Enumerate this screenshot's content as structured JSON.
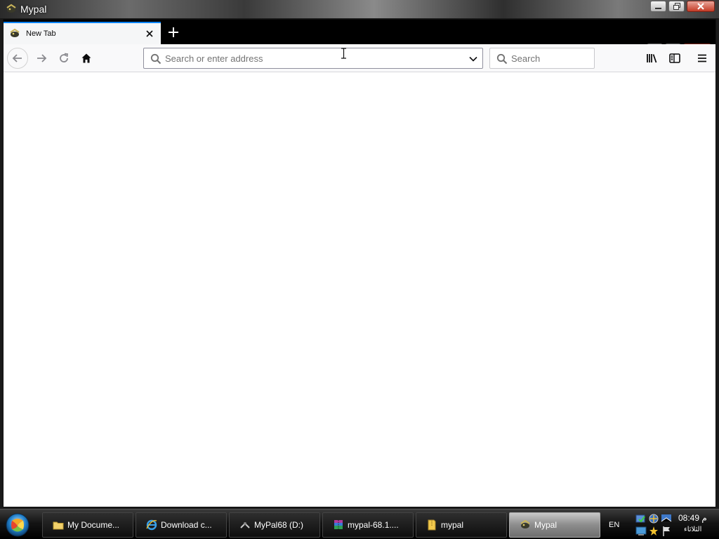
{
  "window": {
    "title": "Mypal"
  },
  "tab": {
    "title": "New Tab"
  },
  "urlbar": {
    "placeholder": "Search or enter address"
  },
  "searchbar": {
    "placeholder": "Search"
  },
  "taskbar": {
    "tasks": [
      {
        "label": "My Docume...",
        "icon": "folder-icon"
      },
      {
        "label": "Download c...",
        "icon": "ie-icon"
      },
      {
        "label": "MyPal68 (D:)",
        "icon": "drive-icon"
      },
      {
        "label": "mypal-68.1....",
        "icon": "archive-icon"
      },
      {
        "label": "mypal",
        "icon": "folder-icon"
      },
      {
        "label": "Mypal",
        "icon": "mypal-icon",
        "active": true
      }
    ],
    "language": "EN",
    "clock_time": "08:49 م",
    "clock_date": "الثلاثاء"
  },
  "colors": {
    "accent": "#0a84ff",
    "close": "#c43b26"
  }
}
